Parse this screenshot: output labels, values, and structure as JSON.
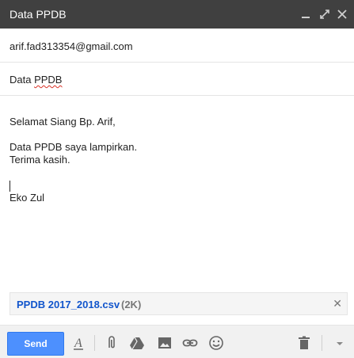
{
  "window": {
    "title": "Data PPDB"
  },
  "to": {
    "value": "arif.fad313354@gmail.com"
  },
  "subject": {
    "value": "Data PPDB"
  },
  "body": {
    "greeting": "Selamat Siang Bp. Arif,",
    "line1": "Data PPDB saya lampirkan.",
    "line2": "Terima kasih.",
    "signature": "Eko Zul"
  },
  "attachment": {
    "name": "PPDB 2017_2018.csv",
    "size": "(2K)"
  },
  "toolbar": {
    "send_label": "Send",
    "icons": [
      "format-text-icon",
      "attach-icon",
      "drive-icon",
      "insert-photo-icon",
      "insert-link-icon",
      "emoji-icon",
      "trash-icon",
      "more-options-icon"
    ]
  },
  "colors": {
    "titlebar": "#404040",
    "send": "#4d90fe",
    "link": "#15c"
  }
}
